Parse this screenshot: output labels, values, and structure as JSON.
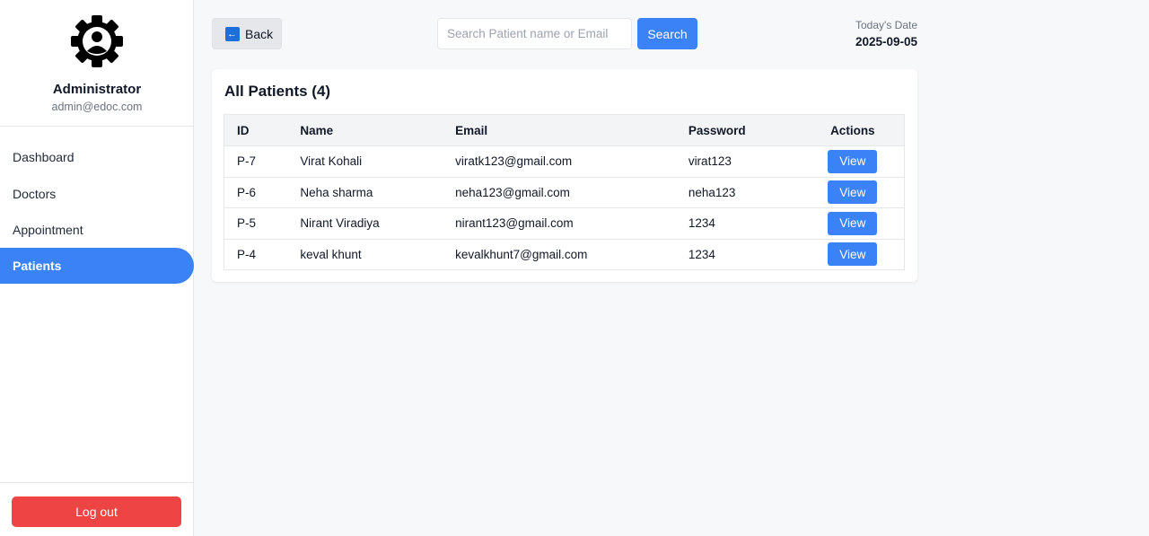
{
  "sidebar": {
    "profile": {
      "name": "Administrator",
      "email": "admin@edoc.com"
    },
    "nav_items": [
      {
        "label": "Dashboard",
        "active": false
      },
      {
        "label": "Doctors",
        "active": false
      },
      {
        "label": "Appointment",
        "active": false
      },
      {
        "label": "Patients",
        "active": true
      }
    ],
    "logout_label": "Log out"
  },
  "header": {
    "back_label": "Back",
    "search_placeholder": "Search Patient name or Email",
    "search_label": "Search",
    "date_label": "Today's Date",
    "date_value": "2025-09-05"
  },
  "patients": {
    "title": "All Patients (4)",
    "columns": [
      "ID",
      "Name",
      "Email",
      "Password",
      "Actions"
    ],
    "rows": [
      {
        "id": "P-7",
        "name": "Virat Kohali",
        "email": "viratk123@gmail.com",
        "password": "virat123",
        "action": "View"
      },
      {
        "id": "P-6",
        "name": "Neha sharma",
        "email": "neha123@gmail.com",
        "password": "neha123",
        "action": "View"
      },
      {
        "id": "P-5",
        "name": "Nirant Viradiya",
        "email": "nirant123@gmail.com",
        "password": "1234",
        "action": "View"
      },
      {
        "id": "P-4",
        "name": "keval khunt",
        "email": "kevalkhunt7@gmail.com",
        "password": "1234",
        "action": "View"
      }
    ]
  },
  "colors": {
    "accent": "#3b82f6",
    "danger": "#ef4444",
    "background": "#f7f8fa"
  },
  "icons": {
    "avatar": "user-gear-icon",
    "back": "back-arrow-icon"
  }
}
